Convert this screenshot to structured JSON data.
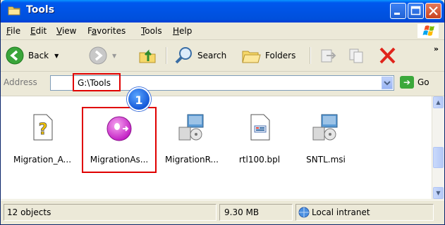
{
  "window": {
    "title": "Tools"
  },
  "menu": {
    "items": [
      "File",
      "Edit",
      "View",
      "Favorites",
      "Tools",
      "Help"
    ],
    "mnemonics": [
      "F",
      "E",
      "V",
      "a",
      "T",
      "H"
    ]
  },
  "toolbar": {
    "back_label": "Back",
    "search_label": "Search",
    "folders_label": "Folders",
    "overflow_label": "»"
  },
  "address": {
    "label": "Address",
    "value": "G:\\Tools",
    "go_label": "Go"
  },
  "callout": {
    "number": "1"
  },
  "files": [
    {
      "label": "Migration_A...",
      "icon": "help-file-icon"
    },
    {
      "label": "MigrationAs...",
      "icon": "app-icon",
      "highlighted": true
    },
    {
      "label": "MigrationR...",
      "icon": "installer-icon"
    },
    {
      "label": "rtl100.bpl",
      "icon": "library-icon"
    },
    {
      "label": "SNTL.msi",
      "icon": "installer-icon"
    }
  ],
  "status": {
    "objects": "12 objects",
    "size": "9.30 MB",
    "zone": "Local intranet"
  },
  "colors": {
    "titlebar": "#0054E3",
    "highlight": "#E00000",
    "callout": "#1659D8"
  }
}
